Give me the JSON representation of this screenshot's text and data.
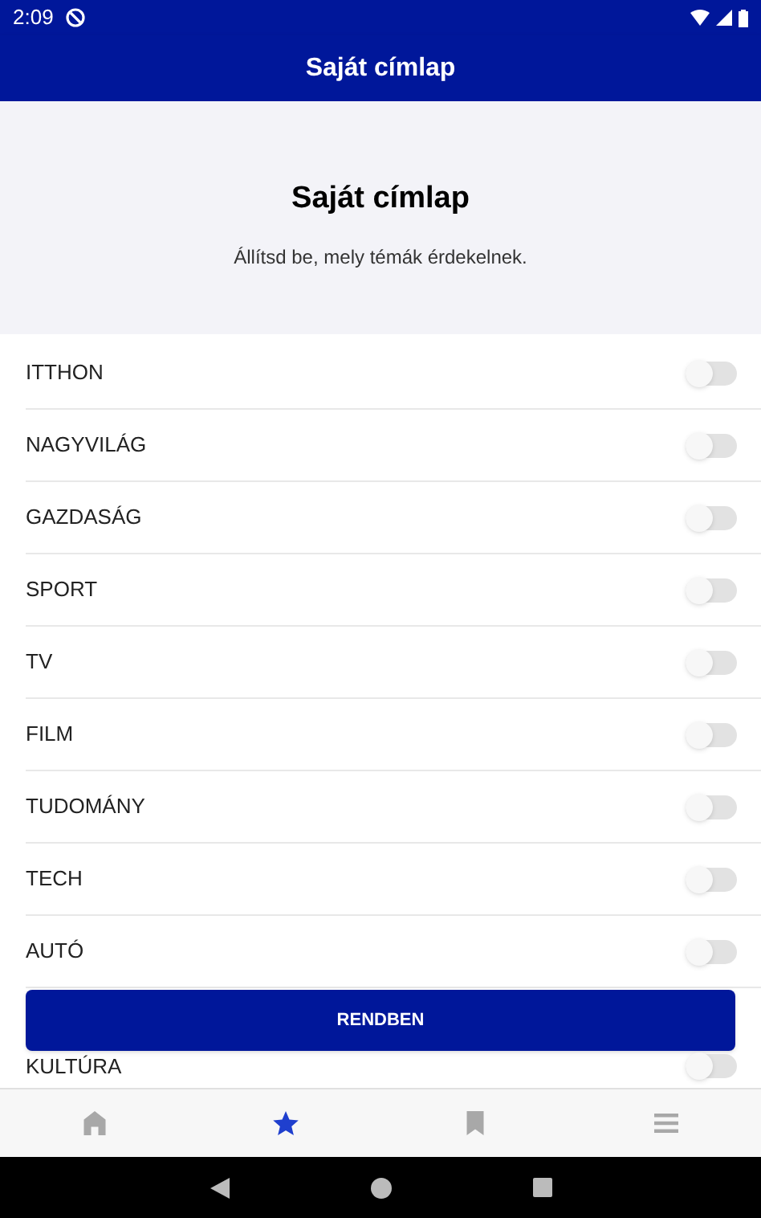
{
  "status_bar": {
    "time": "2:09"
  },
  "app_bar": {
    "title": "Saját címlap"
  },
  "header": {
    "title": "Saját címlap",
    "subtitle": "Állítsd be, mely témák érdekelnek."
  },
  "topics": [
    {
      "label": "ITTHON",
      "on": false
    },
    {
      "label": "NAGYVILÁG",
      "on": false
    },
    {
      "label": "GAZDASÁG",
      "on": false
    },
    {
      "label": "SPORT",
      "on": false
    },
    {
      "label": "TV",
      "on": false
    },
    {
      "label": "FILM",
      "on": false
    },
    {
      "label": "TUDOMÁNY",
      "on": false
    },
    {
      "label": "TECH",
      "on": false
    },
    {
      "label": "AUTÓ",
      "on": false
    },
    {
      "label": "KULTÚRA",
      "on": false
    }
  ],
  "confirm_button": "RENDBEN",
  "bottom_nav": [
    {
      "kind": "home",
      "selected": false
    },
    {
      "kind": "star",
      "selected": true
    },
    {
      "kind": "bookmark",
      "selected": false
    },
    {
      "kind": "menu",
      "selected": false
    }
  ]
}
